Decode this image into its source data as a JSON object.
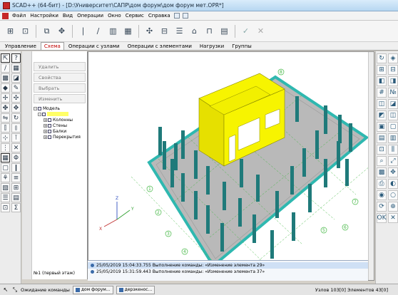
{
  "window": {
    "title": "SCAD++ (64-бит) - [D:\\Университет\\САПР\\дом форум\\дом форум мет.OPR*]"
  },
  "menu": {
    "items": [
      "Файл",
      "Настройки",
      "Вид",
      "Операции",
      "Окно",
      "Сервис",
      "Справка"
    ]
  },
  "tabs": [
    {
      "label": "Управление",
      "selected": false
    },
    {
      "label": "Схема",
      "selected": true
    },
    {
      "label": "Операции с узлами",
      "selected": false
    },
    {
      "label": "Операции с элементами",
      "selected": false
    },
    {
      "label": "Нагрузки",
      "selected": false
    },
    {
      "label": "Группы",
      "selected": false
    }
  ],
  "left_panel": {
    "buttons": [
      "Удалить",
      "Свойства",
      "Выбрать",
      "Изменить"
    ],
    "tree": [
      {
        "label": "Модель",
        "level": 0,
        "expander": "–"
      },
      {
        "label": "",
        "level": 1,
        "expander": "–",
        "highlighted": true
      },
      {
        "label": "Колонны",
        "level": 2,
        "expander": "+"
      },
      {
        "label": "Стены",
        "level": 2,
        "expander": "+"
      },
      {
        "label": "Балки",
        "level": 2,
        "expander": "+"
      },
      {
        "label": "Перекрытия",
        "level": 2,
        "expander": "+"
      }
    ],
    "floor_label": "№1 (первый этаж)"
  },
  "log": [
    "25/05/2019  15:04:33.755 Выполнение команды: «Изменение элемента 29»",
    "25/05/2019  15:31:59.443 Выполнение команды: «Изменение элемента 37»"
  ],
  "taskbar": {
    "status": "Ожидание команды",
    "buttons": [
      "дом форум...",
      "дерзкенос..."
    ],
    "right_text": "Узлов 103[0]  Элементов 43[0]"
  },
  "viewport_labels": {
    "axis": [
      "Z",
      "Y",
      "X"
    ],
    "grid_numbers": [
      "1",
      "2",
      "3",
      "4",
      "5",
      "6",
      "7",
      "8"
    ]
  },
  "colors": {
    "slab": "#b9b9b9",
    "slab_edge": "#2fb8b0",
    "column": "#1f7a7a",
    "walls": "#f7f400",
    "tab_selected": "#c00000"
  }
}
